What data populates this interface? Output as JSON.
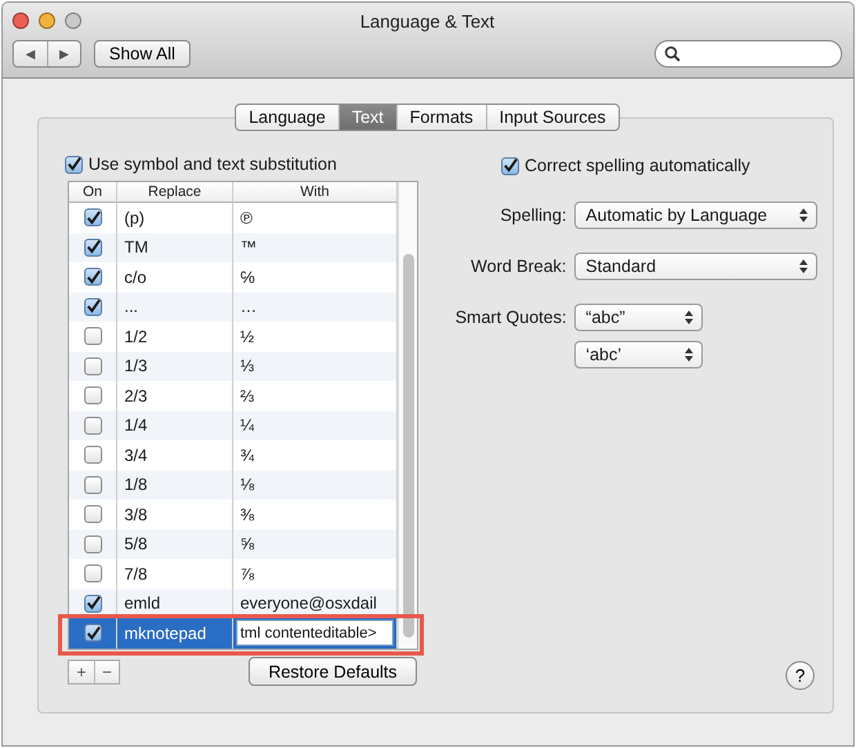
{
  "window": {
    "title": "Language & Text"
  },
  "toolbar": {
    "back": "◀",
    "forward": "▶",
    "show_all": "Show All"
  },
  "tabs": [
    {
      "label": "Language",
      "selected": false
    },
    {
      "label": "Text",
      "selected": true
    },
    {
      "label": "Formats",
      "selected": false
    },
    {
      "label": "Input Sources",
      "selected": false
    }
  ],
  "substitution": {
    "label": "Use symbol and text substitution",
    "checked": true,
    "columns": [
      "On",
      "Replace",
      "With"
    ],
    "rows": [
      {
        "on": true,
        "replace": "(p)",
        "with": "℗",
        "selected": false,
        "editing": false
      },
      {
        "on": true,
        "replace": "TM",
        "with": "™",
        "selected": false,
        "editing": false
      },
      {
        "on": true,
        "replace": "c/o",
        "with": "℅",
        "selected": false,
        "editing": false
      },
      {
        "on": true,
        "replace": "...",
        "with": "…",
        "selected": false,
        "editing": false
      },
      {
        "on": false,
        "replace": "1/2",
        "with": "½",
        "selected": false,
        "editing": false
      },
      {
        "on": false,
        "replace": "1/3",
        "with": "⅓",
        "selected": false,
        "editing": false
      },
      {
        "on": false,
        "replace": "2/3",
        "with": "⅔",
        "selected": false,
        "editing": false
      },
      {
        "on": false,
        "replace": "1/4",
        "with": "¼",
        "selected": false,
        "editing": false
      },
      {
        "on": false,
        "replace": "3/4",
        "with": "¾",
        "selected": false,
        "editing": false
      },
      {
        "on": false,
        "replace": "1/8",
        "with": "⅛",
        "selected": false,
        "editing": false
      },
      {
        "on": false,
        "replace": "3/8",
        "with": "⅜",
        "selected": false,
        "editing": false
      },
      {
        "on": false,
        "replace": "5/8",
        "with": "⅝",
        "selected": false,
        "editing": false
      },
      {
        "on": false,
        "replace": "7/8",
        "with": "⅞",
        "selected": false,
        "editing": false
      },
      {
        "on": true,
        "replace": "emld",
        "with": "everyone@osxdail",
        "selected": false,
        "editing": false
      },
      {
        "on": true,
        "replace": "mknotepad",
        "with": "tml contenteditable>",
        "selected": true,
        "editing": true
      }
    ],
    "add": "+",
    "remove": "−",
    "restore": "Restore Defaults"
  },
  "spelling": {
    "correct": {
      "label": "Correct spelling automatically",
      "checked": true
    },
    "spelling": {
      "label": "Spelling:",
      "value": "Automatic by Language"
    },
    "word_break": {
      "label": "Word Break:",
      "value": "Standard"
    },
    "smart_quotes": {
      "label": "Smart Quotes:",
      "double": "“abc”",
      "single": "‘abc’"
    }
  },
  "help": "?"
}
